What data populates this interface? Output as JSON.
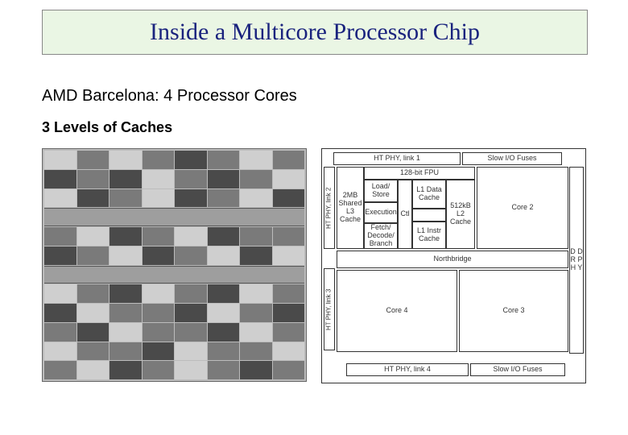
{
  "title": "Inside a Multicore Processor Chip",
  "subtitle": "AMD Barcelona: 4 Processor Cores",
  "caches": "3 Levels of Caches",
  "floorplan": {
    "top_left": "HT PHY, link 1",
    "top_right": "Slow I/O Fuses",
    "left_link2": "HT PHY, link 2",
    "left_link3": "HT PHY, link 3",
    "right_phy": "D D R P H Y",
    "fpu": "128-bit FPU",
    "l3": "2MB Shared L3 Cache",
    "load_store": "Load/ Store",
    "exec": "Execution",
    "fetch": "Fetch/ Decode/ Branch",
    "ctl": "Ctl",
    "l1d": "L1 Data Cache",
    "l1i": "L1 Instr Cache",
    "l2": "512kB L2 Cache",
    "core2": "Core 2",
    "core3": "Core 3",
    "core4": "Core 4",
    "northbridge": "Northbridge",
    "bottom_left": "HT PHY, link 4",
    "bottom_right": "Slow I/O Fuses"
  }
}
